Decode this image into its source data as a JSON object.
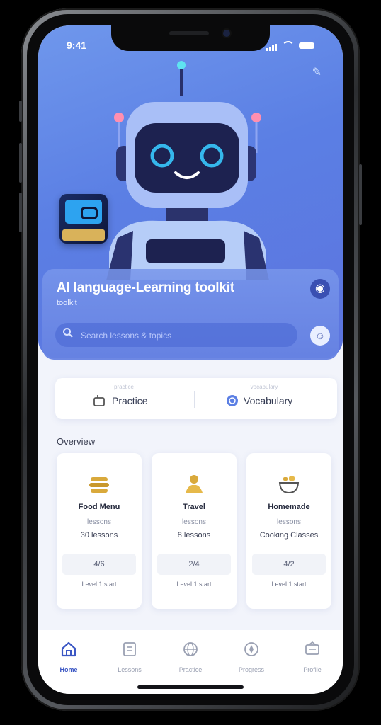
{
  "status": {
    "time": "9:41"
  },
  "hero": {
    "title": "AI language-Learning toolkit",
    "subtitle": "toolkit",
    "search_placeholder": "Search lessons & topics"
  },
  "tabs": [
    {
      "caption": "practice",
      "label": "Practice",
      "icon": "chat-icon"
    },
    {
      "caption": "vocabulary",
      "label": "Vocabulary",
      "icon": "book-globe-icon"
    }
  ],
  "section": {
    "title": "Overview"
  },
  "cards": [
    {
      "icon": "dumpling-icon",
      "name": "Food Menu",
      "meta": "lessons",
      "count": "30 lessons",
      "inner": "4/6",
      "foot": "Level 1 start"
    },
    {
      "icon": "travel-icon",
      "name": "Travel",
      "meta": "lessons",
      "count": "8 lessons",
      "inner": "2/4",
      "foot": "Level 1 start"
    },
    {
      "icon": "bowl-icon",
      "name": "Homemade",
      "meta": "lessons",
      "count": "Cooking Classes",
      "inner": "4/2",
      "foot": "Level 1 start"
    }
  ],
  "nav": [
    {
      "label": "Home",
      "icon": "home-icon",
      "active": true
    },
    {
      "label": "Lessons",
      "icon": "lessons-icon"
    },
    {
      "label": "Practice",
      "icon": "globe-icon"
    },
    {
      "label": "Progress",
      "icon": "compass-icon"
    },
    {
      "label": "Profile",
      "icon": "profile-icon"
    }
  ],
  "colors": {
    "accent": "#3b57c4",
    "hero": "#5b7fe4",
    "icon_gold": "#d9a93b"
  }
}
